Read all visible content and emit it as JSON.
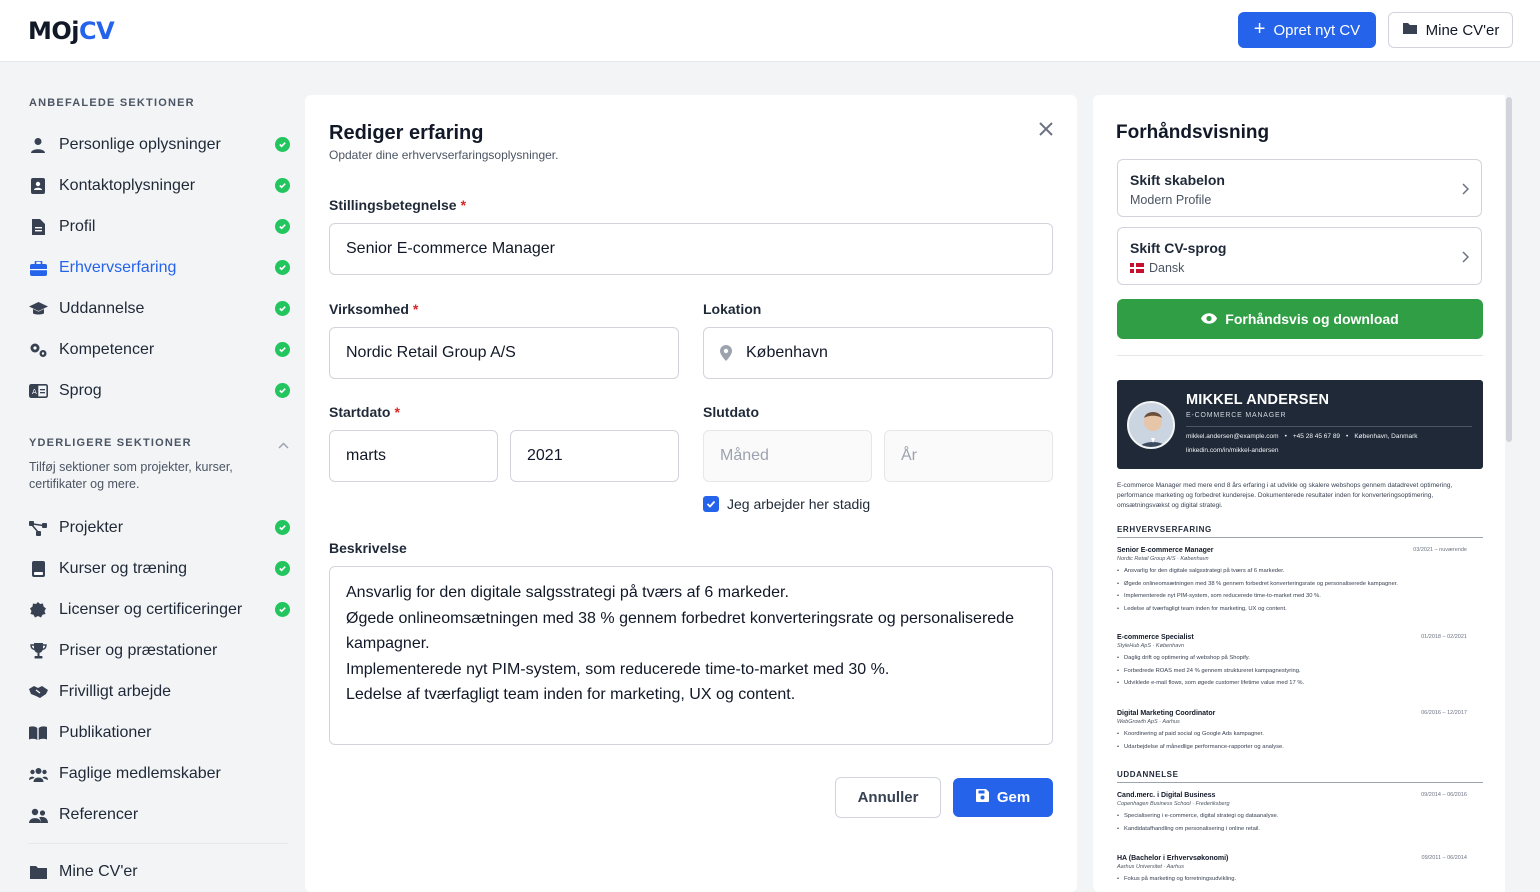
{
  "header": {
    "logo_a": "MOj",
    "logo_b": "CV",
    "new_cv_label": "Opret nyt CV",
    "my_cvs_label": "Mine CV'er"
  },
  "sidebar": {
    "recommended_title": "ANBEFALEDE SEKTIONER",
    "recommended": [
      {
        "label": "Personlige oplysninger",
        "icon": "person-icon",
        "done": true
      },
      {
        "label": "Kontaktoplysninger",
        "icon": "contact-card-icon",
        "done": true
      },
      {
        "label": "Profil",
        "icon": "document-icon",
        "done": true
      },
      {
        "label": "Erhvervserfaring",
        "icon": "briefcase-icon",
        "done": true,
        "active": true
      },
      {
        "label": "Uddannelse",
        "icon": "graduation-cap-icon",
        "done": true
      },
      {
        "label": "Kompetencer",
        "icon": "gears-icon",
        "done": true
      },
      {
        "label": "Sprog",
        "icon": "language-icon",
        "done": true
      }
    ],
    "additional_title": "YDERLIGERE SEKTIONER",
    "additional_sub": "Tilføj sektioner som projekter, kurser, certifikater og mere.",
    "additional": [
      {
        "label": "Projekter",
        "icon": "diagram-icon",
        "done": true
      },
      {
        "label": "Kurser og træning",
        "icon": "book-icon",
        "done": true
      },
      {
        "label": "Licenser og certificeringer",
        "icon": "certificate-icon",
        "done": true
      },
      {
        "label": "Priser og præstationer",
        "icon": "trophy-icon",
        "done": false
      },
      {
        "label": "Frivilligt arbejde",
        "icon": "handshake-icon",
        "done": false
      },
      {
        "label": "Publikationer",
        "icon": "open-book-icon",
        "done": false
      },
      {
        "label": "Faglige medlemskaber",
        "icon": "people-group-icon",
        "done": false
      },
      {
        "label": "Referencer",
        "icon": "users-icon",
        "done": false
      }
    ],
    "my_cvs": "Mine CV'er"
  },
  "editor": {
    "title": "Rediger erfaring",
    "subtitle": "Opdater dine erhvervserfaringsoplysninger.",
    "job_title_label": "Stillingsbetegnelse",
    "job_title_value": "Senior E-commerce Manager",
    "company_label": "Virksomhed",
    "company_value": "Nordic Retail Group A/S",
    "location_label": "Lokation",
    "location_value": "København",
    "start_label": "Startdato",
    "start_month": "marts",
    "start_year": "2021",
    "end_label": "Slutdato",
    "end_month_placeholder": "Måned",
    "end_year_placeholder": "År",
    "current_label": "Jeg arbejder her stadig",
    "current_checked": true,
    "description_label": "Beskrivelse",
    "description_lines": [
      "Ansvarlig for den digitale salgsstrategi på tværs af 6 markeder.",
      "Øgede onlineomsætningen med 38 % gennem forbedret konverteringsrate og personaliserede kampagner.",
      "Implementerede nyt PIM-system, som reducerede time-to-market med 30 %.",
      "Ledelse af tværfagligt team inden for marketing, UX og content."
    ],
    "cancel_label": "Annuller",
    "save_label": "Gem"
  },
  "preview": {
    "title": "Forhåndsvisning",
    "template_title": "Skift skabelon",
    "template_value": "Modern Profile",
    "language_title": "Skift CV-sprog",
    "language_value": "Dansk",
    "download_label": "Forhåndsvis og download",
    "cv": {
      "name": "MIKKEL ANDERSEN",
      "role": "E-COMMERCE MANAGER",
      "email": "mikkel.andersen@example.com",
      "phone": "+45 28 45 67 89",
      "city": "København, Danmark",
      "linkedin": "linkedin.com/in/mikkel-andersen",
      "summary": "E-commerce Manager med mere end 8 års erfaring i at udvikle og skalere webshops gennem datadrevet optimering, performance marketing og forbedret kunderejse. Dokumenterede resultater inden for konverteringsoptimering, omsætningsvækst og digital strategi.",
      "experience_title": "ERHVERVSERFARING",
      "jobs": [
        {
          "title": "Senior E-commerce Manager",
          "company": "Nordic Retail Group A/S · København",
          "dates": "03/2021 – nuværende",
          "bullets": [
            "Ansvarlig for den digitale salgsstrategi på tværs af 6 markeder.",
            "Øgede onlineomsætningen med 38 % gennem forbedret konverteringsrate og personaliserede kampagner.",
            "Implementerede nyt PIM-system, som reducerede time-to-market med 30 %.",
            "Ledelse af tværfagligt team inden for marketing, UX og content."
          ]
        },
        {
          "title": "E-commerce Specialist",
          "company": "StyleHub ApS · København",
          "dates": "01/2018 – 02/2021",
          "bullets": [
            "Daglig drift og optimering af webshop på Shopify.",
            "Forbedrede ROAS med 24 % gennem struktureret kampagnestyring.",
            "Udviklede e-mail flows, som øgede customer lifetime value med 17 %."
          ]
        },
        {
          "title": "Digital Marketing Coordinator",
          "company": "WebGrowth ApS · Aarhus",
          "dates": "06/2016 – 12/2017",
          "bullets": [
            "Koordinering af paid social og Google Ads kampagner.",
            "Udarbejdelse af månedlige performance-rapporter og analyse."
          ]
        }
      ],
      "education_title": "UDDANNELSE",
      "education": [
        {
          "title": "Cand.merc. i Digital Business",
          "company": "Copenhagen Business School · Frederiksberg",
          "dates": "09/2014 – 06/2016",
          "bullets": [
            "Specialisering i e-commerce, digital strategi og dataanalyse.",
            "Kandidatafhandling om personalisering i online retail."
          ]
        },
        {
          "title": "HA (Bachelor i Erhvervsøkonomi)",
          "company": "Aarhus Universitet · Aarhus",
          "dates": "09/2011 – 06/2014",
          "bullets": [
            "Fokus på marketing og forretningsudvikling."
          ]
        }
      ]
    }
  },
  "colors": {
    "primary": "#2563eb",
    "success": "#22c55e",
    "download": "#2f9e44",
    "required": "#dc2626",
    "cv_header": "#1f2937"
  }
}
